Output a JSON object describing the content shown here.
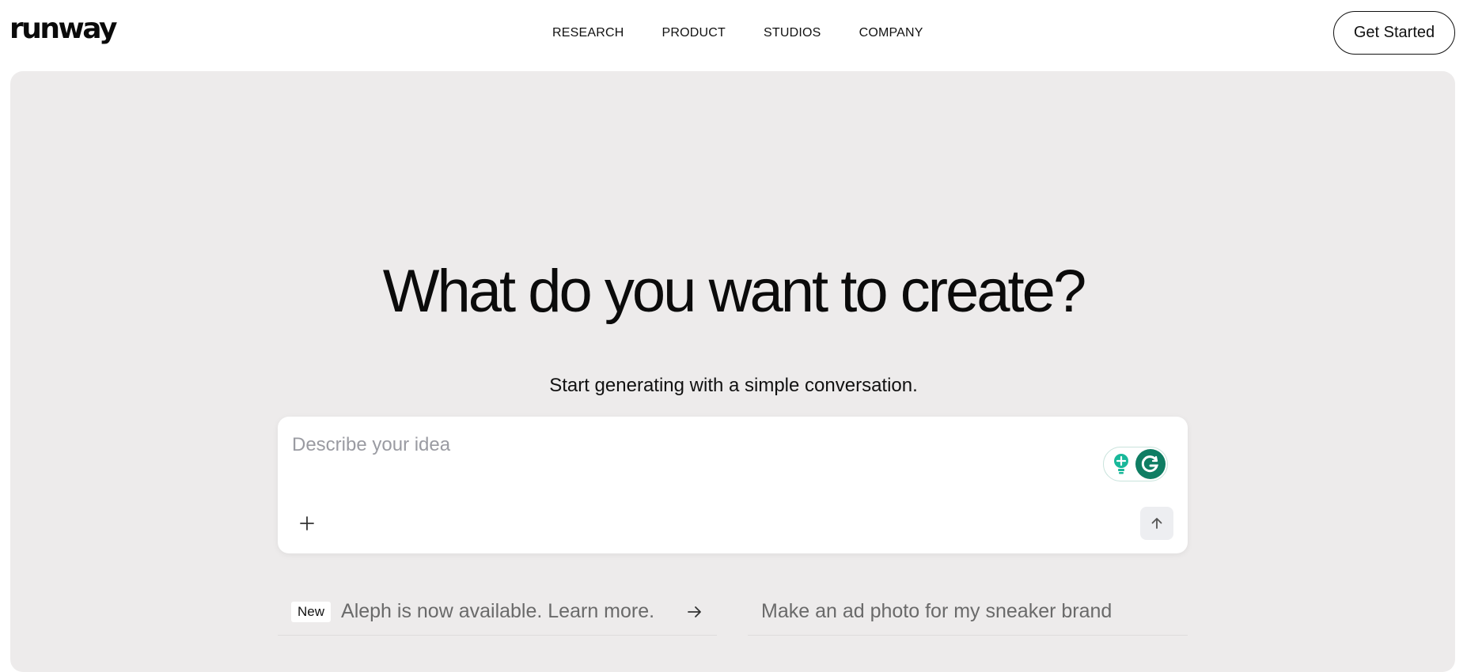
{
  "header": {
    "logo": "runway",
    "nav": [
      "RESEARCH",
      "PRODUCT",
      "STUDIOS",
      "COMPANY"
    ],
    "cta_label": "Get Started"
  },
  "hero": {
    "title": "What do you want to create?",
    "subtitle": "Start generating with a simple conversation.",
    "prompt_placeholder": "Describe your idea",
    "suggestions": {
      "left_badge": "New",
      "left_text": "Aleph is now available. Learn more.",
      "right_text": "Make an ad photo for my sneaker brand"
    }
  },
  "colors": {
    "hero_bg": "#edebeb",
    "grammarly_green": "#0f7d63",
    "bulb_teal": "#19b89a"
  },
  "icons": [
    "plus-icon",
    "arrow-up-icon",
    "arrow-right-icon",
    "lightbulb-icon",
    "grammarly-icon"
  ]
}
